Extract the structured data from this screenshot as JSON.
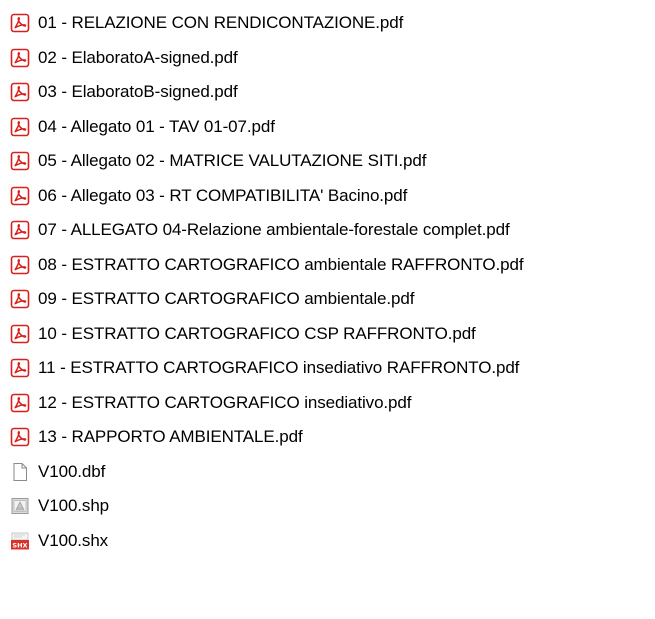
{
  "files": [
    {
      "name": "01 - RELAZIONE CON RENDICONTAZIONE.pdf",
      "icon": "pdf-icon"
    },
    {
      "name": "02 - ElaboratoA-signed.pdf",
      "icon": "pdf-icon"
    },
    {
      "name": "03 - ElaboratoB-signed.pdf",
      "icon": "pdf-icon"
    },
    {
      "name": "04 - Allegato 01 - TAV 01-07.pdf",
      "icon": "pdf-icon"
    },
    {
      "name": "05 - Allegato 02 - MATRICE VALUTAZIONE SITI.pdf",
      "icon": "pdf-icon"
    },
    {
      "name": "06 - Allegato 03 - RT COMPATIBILITA' Bacino.pdf",
      "icon": "pdf-icon"
    },
    {
      "name": "07 - ALLEGATO 04-Relazione ambientale-forestale complet.pdf",
      "icon": "pdf-icon"
    },
    {
      "name": "08 - ESTRATTO CARTOGRAFICO ambientale RAFFRONTO.pdf",
      "icon": "pdf-icon"
    },
    {
      "name": "09 - ESTRATTO CARTOGRAFICO ambientale.pdf",
      "icon": "pdf-icon"
    },
    {
      "name": "10 - ESTRATTO CARTOGRAFICO CSP RAFFRONTO.pdf",
      "icon": "pdf-icon"
    },
    {
      "name": "11 - ESTRATTO CARTOGRAFICO insediativo RAFFRONTO.pdf",
      "icon": "pdf-icon"
    },
    {
      "name": "12 - ESTRATTO CARTOGRAFICO insediativo.pdf",
      "icon": "pdf-icon"
    },
    {
      "name": "13 - RAPPORTO AMBIENTALE.pdf",
      "icon": "pdf-icon"
    },
    {
      "name": "V100.dbf",
      "icon": "blank-file-icon"
    },
    {
      "name": "V100.shp",
      "icon": "shp-file-icon"
    },
    {
      "name": "V100.shx",
      "icon": "shx-file-icon"
    }
  ],
  "colors": {
    "pdf_red": "#d8201c",
    "shx_red": "#d9342b",
    "file_border": "#8a8a8a",
    "text": "#000000"
  },
  "labels": {
    "shx_badge": "SHX"
  }
}
